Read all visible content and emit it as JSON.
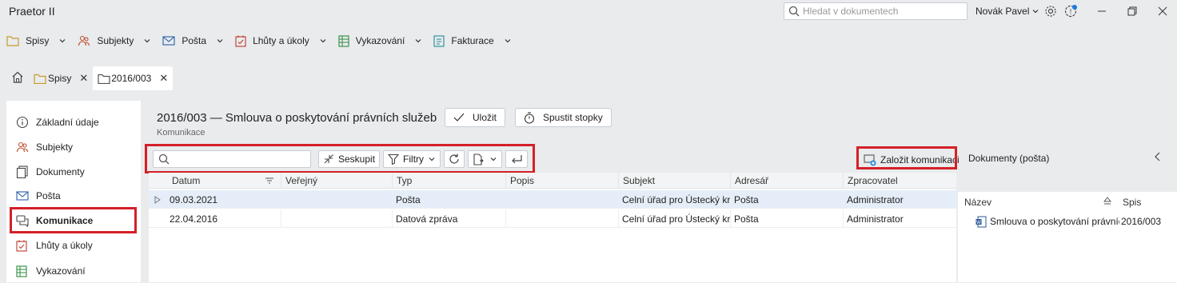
{
  "app": {
    "title": "Praetor II"
  },
  "titlebar": {
    "search_placeholder": "Hledat v dokumentech",
    "user_name": "Novák Pavel",
    "icons": [
      "settings-gear-icon",
      "notifications-icon",
      "minimize-icon",
      "restore-icon",
      "close-icon"
    ]
  },
  "menu": {
    "items": [
      {
        "label": "Spisy",
        "icon": "folder-icon"
      },
      {
        "label": "Subjekty",
        "icon": "people-icon"
      },
      {
        "label": "Pošta",
        "icon": "mail-icon"
      },
      {
        "label": "Lhůty a úkoly",
        "icon": "calendar-check-icon"
      },
      {
        "label": "Vykazování",
        "icon": "spreadsheet-icon"
      },
      {
        "label": "Fakturace",
        "icon": "invoice-icon"
      }
    ]
  },
  "tabs": [
    {
      "label": "",
      "icon": "home-icon"
    },
    {
      "label": "Spisy",
      "icon": "folder-icon"
    },
    {
      "label": "2016/003",
      "icon": "folder-icon",
      "active": true
    }
  ],
  "sidebar": {
    "items": [
      {
        "label": "Základní údaje",
        "icon": "info-icon"
      },
      {
        "label": "Subjekty",
        "icon": "people-icon"
      },
      {
        "label": "Dokumenty",
        "icon": "documents-icon"
      },
      {
        "label": "Pošta",
        "icon": "mail-icon"
      },
      {
        "label": "Komunikace",
        "icon": "chat-icon",
        "active": true
      },
      {
        "label": "Lhůty a úkoly",
        "icon": "calendar-check-icon"
      },
      {
        "label": "Vykazování",
        "icon": "spreadsheet-icon"
      }
    ]
  },
  "header": {
    "title": "2016/003 — Smlouva o poskytování právních služeb",
    "subtitle": "Komunikace",
    "save_label": "Uložit",
    "stopwatch_label": "Spustit stopky"
  },
  "toolbar": {
    "search_value": "",
    "group_label": "Seskupit",
    "filter_label": "Filtry",
    "create_label": "Založit komunikaci"
  },
  "grid": {
    "columns": [
      "Datum",
      "Veřejný",
      "Typ",
      "Popis",
      "Subjekt",
      "Adresář",
      "Zpracovatel"
    ],
    "rows": [
      {
        "datum": "09.03.2021",
        "verejny": "",
        "typ": "Pošta",
        "popis": "",
        "subjekt": "Celní úřad pro Ústecký kra",
        "adresar": "Pošta",
        "zpracovatel": "Administrator"
      },
      {
        "datum": "22.04.2016",
        "verejny": "",
        "typ": "Datová zpráva",
        "popis": "",
        "subjekt": "Celní úřad pro Ústecký kra",
        "adresar": "Pošta",
        "zpracovatel": "Administrator"
      }
    ]
  },
  "right_panel": {
    "title": "Dokumenty (pošta)",
    "col_name": "Název",
    "col_spis": "Spis",
    "rows": [
      {
        "name": "Smlouva o poskytování právníc",
        "spis": "2016/003",
        "icon": "word-document-icon"
      }
    ]
  },
  "colors": {
    "highlight_border": "#d42027",
    "selected_row": "#e5eef8"
  }
}
